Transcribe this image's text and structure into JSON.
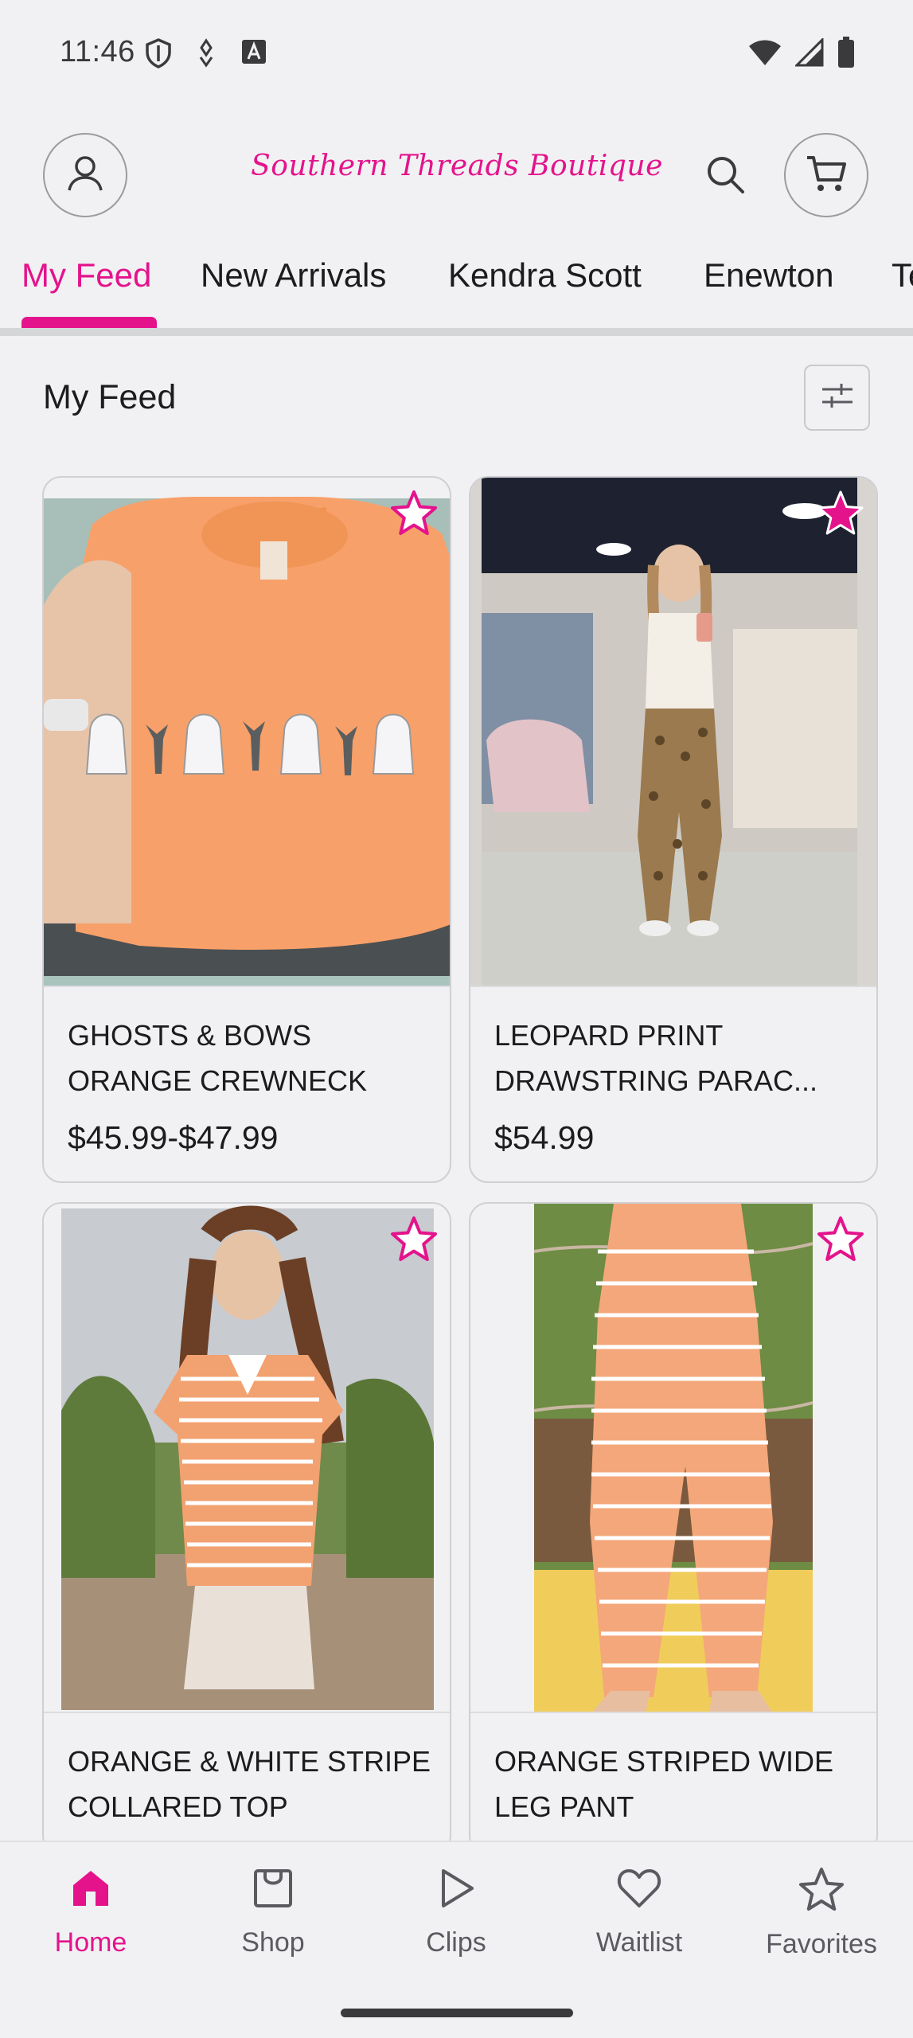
{
  "status_bar": {
    "time": "11:46"
  },
  "header": {
    "brand": "Southern Threads Boutique"
  },
  "tabs": [
    {
      "label": "My Feed",
      "active": true
    },
    {
      "label": "New Arrivals",
      "active": false
    },
    {
      "label": "Kendra Scott",
      "active": false
    },
    {
      "label": "Enewton",
      "active": false
    },
    {
      "label": "Te",
      "active": false
    }
  ],
  "feed": {
    "title": "My Feed"
  },
  "products": [
    {
      "name": "GHOSTS & BOWS ORANGE CREWNECK",
      "price": "$45.99-$47.99",
      "image": "orange crewneck with ghosts and bows"
    },
    {
      "name": "LEOPARD PRINT DRAWSTRING PARAC...",
      "price": "$54.99",
      "image": "woman in leopard print pants in boutique"
    },
    {
      "name": "ORANGE & WHITE STRIPE COLLARED TOP",
      "price": "",
      "image": "woman in orange striped collared top"
    },
    {
      "name": "ORANGE STRIPED WIDE LEG PANT",
      "price": "",
      "image": "orange striped wide leg pants"
    }
  ],
  "bottom_nav": [
    {
      "label": "Home",
      "icon": "home-icon",
      "active": true
    },
    {
      "label": "Shop",
      "icon": "shopping-bag-icon",
      "active": false
    },
    {
      "label": "Clips",
      "icon": "play-icon",
      "active": false
    },
    {
      "label": "Waitlist",
      "icon": "heart-icon",
      "active": false
    },
    {
      "label": "Favorites",
      "icon": "star-icon",
      "active": false
    }
  ],
  "colors": {
    "accent": "#e4138c",
    "background": "#f1f1f3",
    "text": "#1c1c1e"
  }
}
